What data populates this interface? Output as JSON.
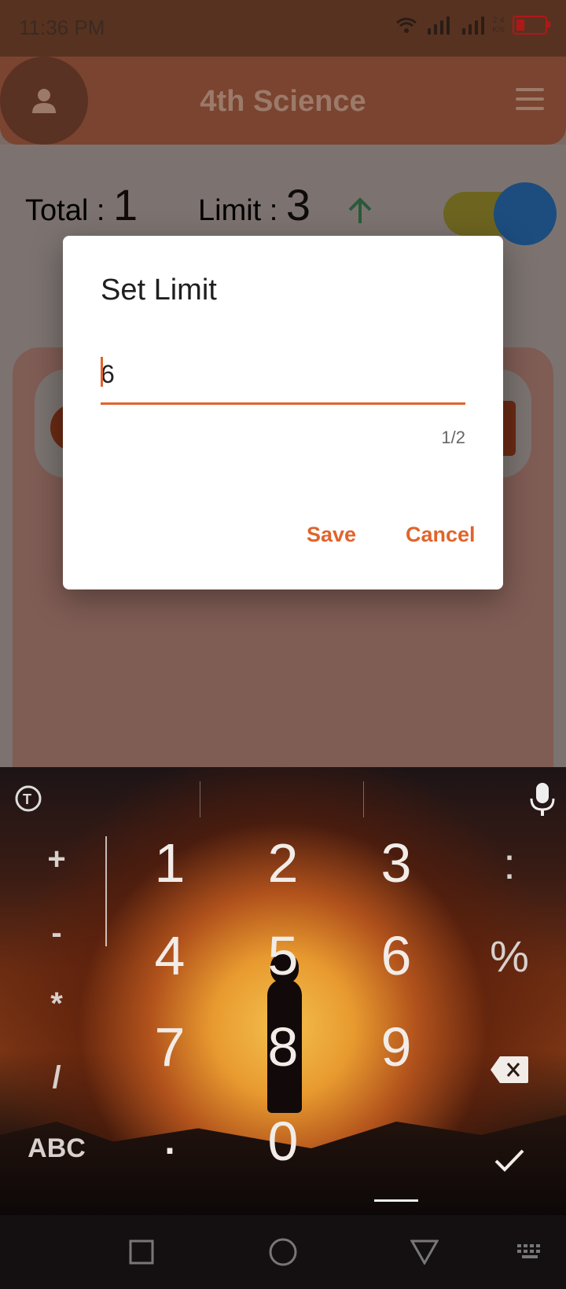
{
  "status": {
    "time": "11:36 PM",
    "speed": "2.4",
    "speed_unit": "K/s"
  },
  "appbar": {
    "title": "4th Science"
  },
  "stats": {
    "total_label": "Total : ",
    "total_value": "1",
    "limit_label": "Limit : ",
    "limit_value": "3"
  },
  "dialog": {
    "title": "Set Limit",
    "input_value": "6",
    "counter": "1/2",
    "save_label": "Save",
    "cancel_label": "Cancel"
  },
  "keyboard": {
    "left_keys": [
      "+",
      "-",
      "*",
      "/"
    ],
    "abc": "ABC",
    "digits": [
      "1",
      "2",
      "3",
      "4",
      "5",
      "6",
      "7",
      "8",
      "9",
      "0"
    ],
    "dot": ".",
    "right_keys": [
      ":",
      "%"
    ]
  },
  "colors": {
    "accent": "#e0642c",
    "appbar": "#7a4430",
    "status_bar": "#583220"
  }
}
